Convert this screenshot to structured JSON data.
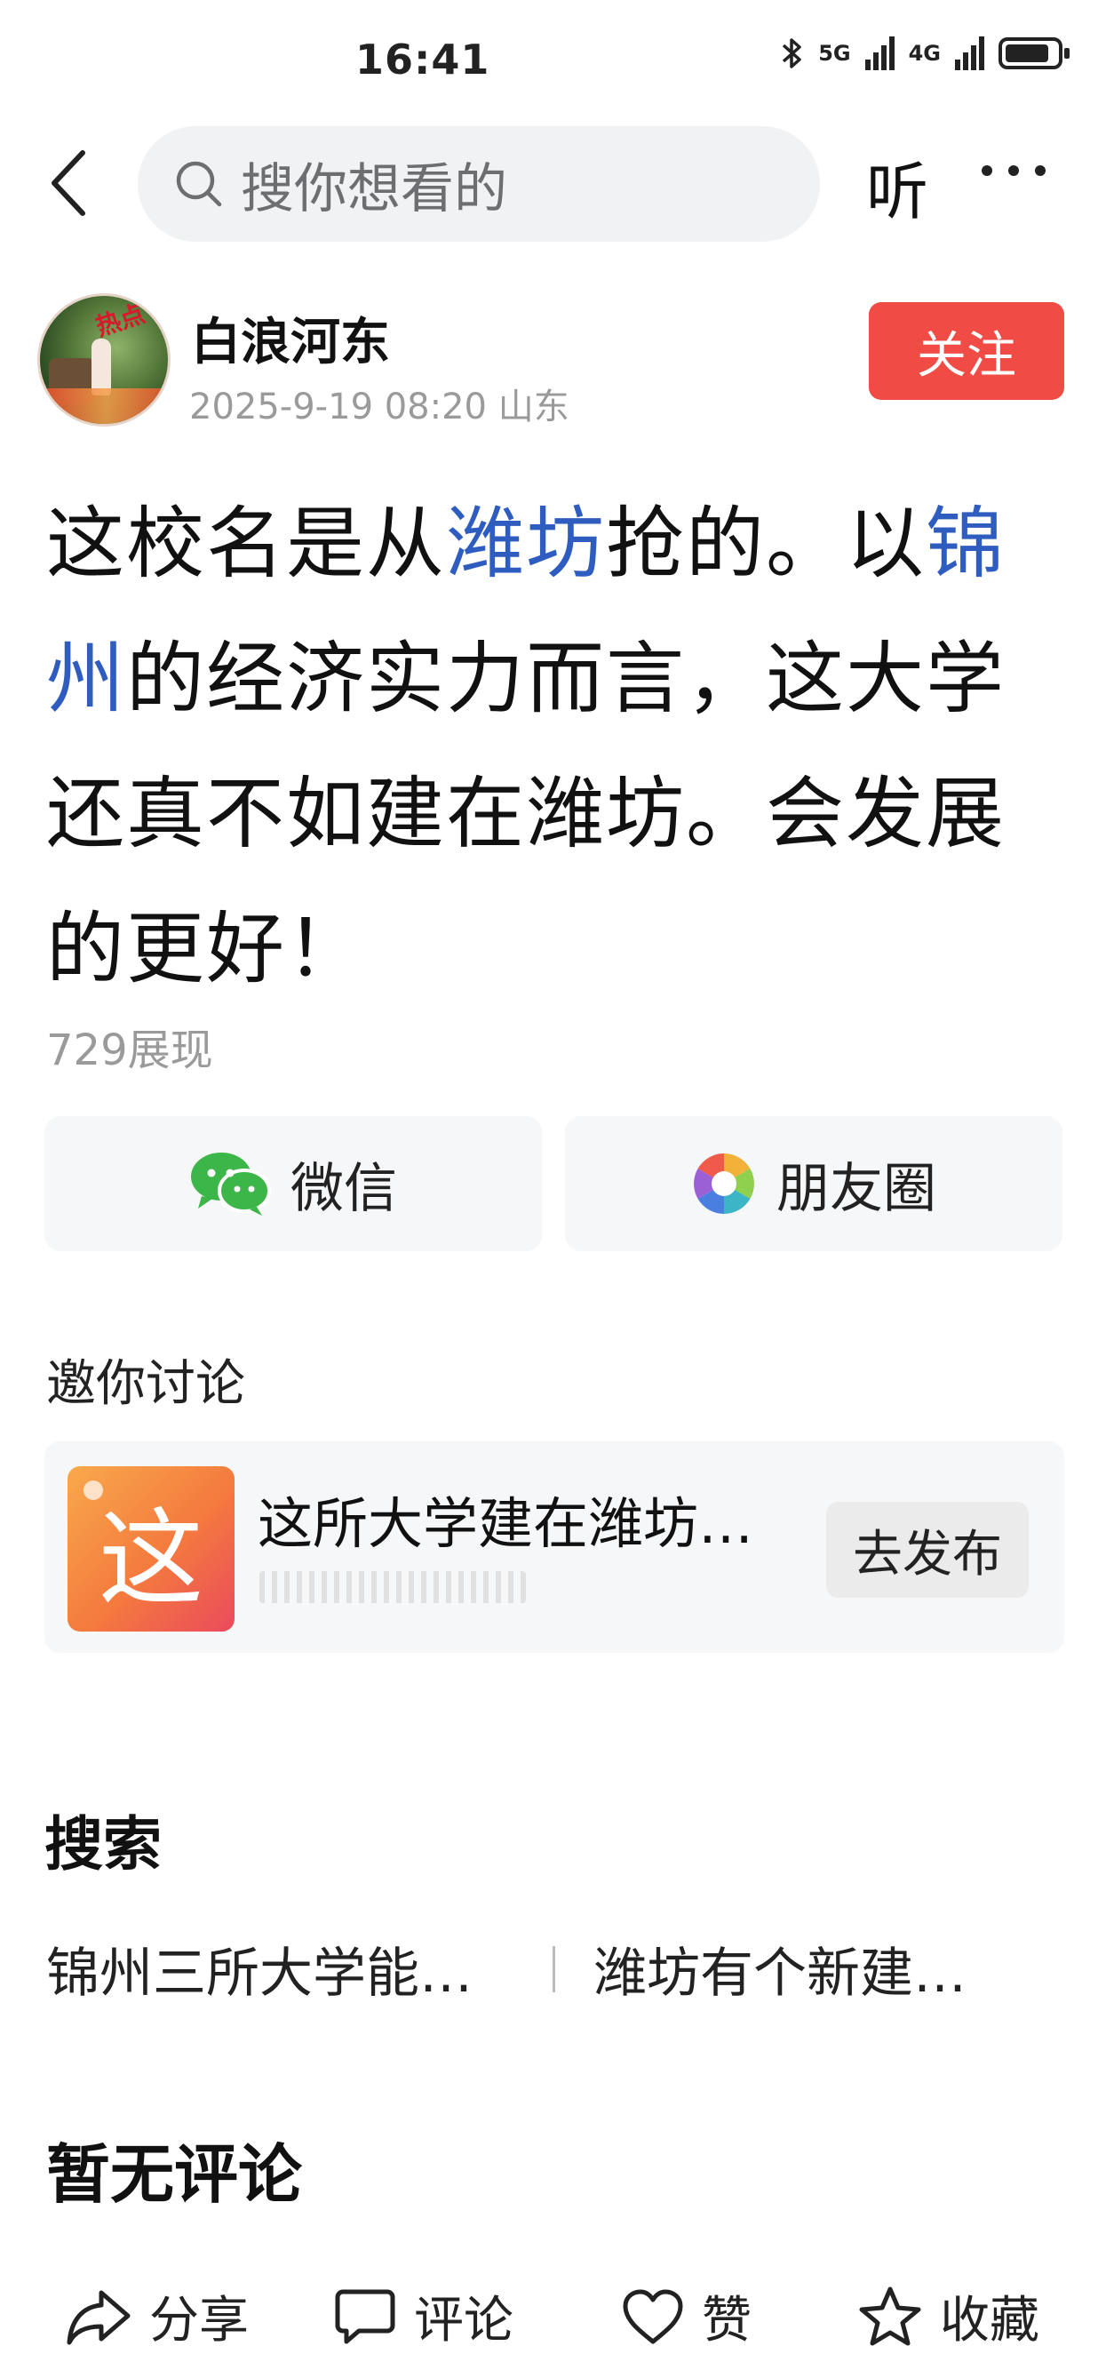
{
  "status_bar": {
    "time": "16:41",
    "network_1": "5G",
    "network_2": "4G"
  },
  "search": {
    "placeholder": "搜你想看的"
  },
  "header": {
    "listen_label": "听"
  },
  "author": {
    "name": "白浪河东",
    "meta": "2025-9-19 08:20 山东",
    "follow_label": "关注",
    "avatar_tag": "热点"
  },
  "post": {
    "segments": [
      "这校名是从",
      "潍坊",
      "抢的。以",
      "锦州",
      "的经济实力而言，这大学还真不如建在潍坊。会发展的更好！"
    ],
    "views": "729展现"
  },
  "share": {
    "wechat_label": "微信",
    "moments_label": "朋友圈"
  },
  "invite": {
    "title": "邀你讨论",
    "topic_icon_char": "这",
    "topic_title": "这所大学建在潍坊…",
    "post_label": "去发布"
  },
  "related_search": {
    "title": "搜索",
    "items": [
      "锦州三所大学能…",
      "潍坊有个新建…"
    ]
  },
  "comments": {
    "empty_label": "暂无评论"
  },
  "bottom_bar": {
    "share_label": "分享",
    "comment_label": "评论",
    "like_label": "赞",
    "favorite_label": "收藏"
  },
  "colors": {
    "accent_red": "#f04b45",
    "link_blue": "#2f5dbf"
  }
}
